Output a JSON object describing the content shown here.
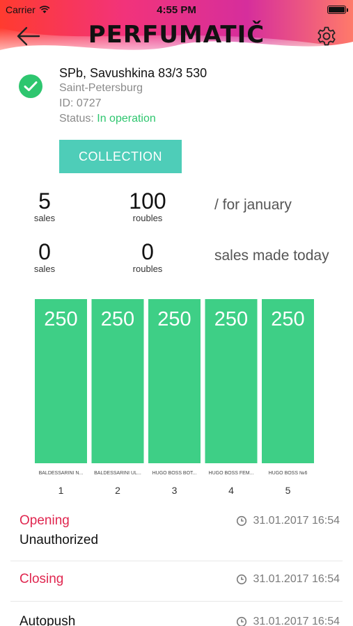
{
  "statusbar": {
    "carrier": "Carrier",
    "time": "4:55 PM"
  },
  "header": {
    "logo": "PERFUMATIČ"
  },
  "location": {
    "address": "SPb, Savushkina 83/3 530",
    "city": "Saint-Petersburg",
    "id_line": "ID: 0727",
    "status_label": "Status:",
    "status_value": "In operation"
  },
  "collection_button": "COLLECTION",
  "stats": {
    "month": {
      "sales_value": "5",
      "sales_label": "sales",
      "roubles_value": "100",
      "roubles_label": "roubles",
      "caption": "/ for january"
    },
    "today": {
      "sales_value": "0",
      "sales_label": "sales",
      "roubles_value": "0",
      "roubles_label": "roubles",
      "caption": "sales made today"
    }
  },
  "chart_data": {
    "type": "bar",
    "categories": [
      "BALDESSARINI N...",
      "BALDESSARINI UL...",
      "HUGO BOSS BOT...",
      "HUGO BOSS FEM...",
      "HUGO BOSS №6"
    ],
    "slots": [
      "1",
      "2",
      "3",
      "4",
      "5"
    ],
    "values": [
      250,
      250,
      250,
      250,
      250
    ],
    "ylim": [
      0,
      250
    ],
    "color": "#3ecf86"
  },
  "events": [
    {
      "title": "Opening",
      "time": "31.01.2017 16:54",
      "subtitle": "Unauthorized"
    },
    {
      "title": "Closing",
      "time": "31.01.2017 16:54"
    },
    {
      "title": "Autopush",
      "time": "31.01.2017 16:54"
    }
  ],
  "colors": {
    "accent_green": "#2ec66f",
    "button_teal": "#4ecdb8",
    "event_red": "#e0264f"
  }
}
